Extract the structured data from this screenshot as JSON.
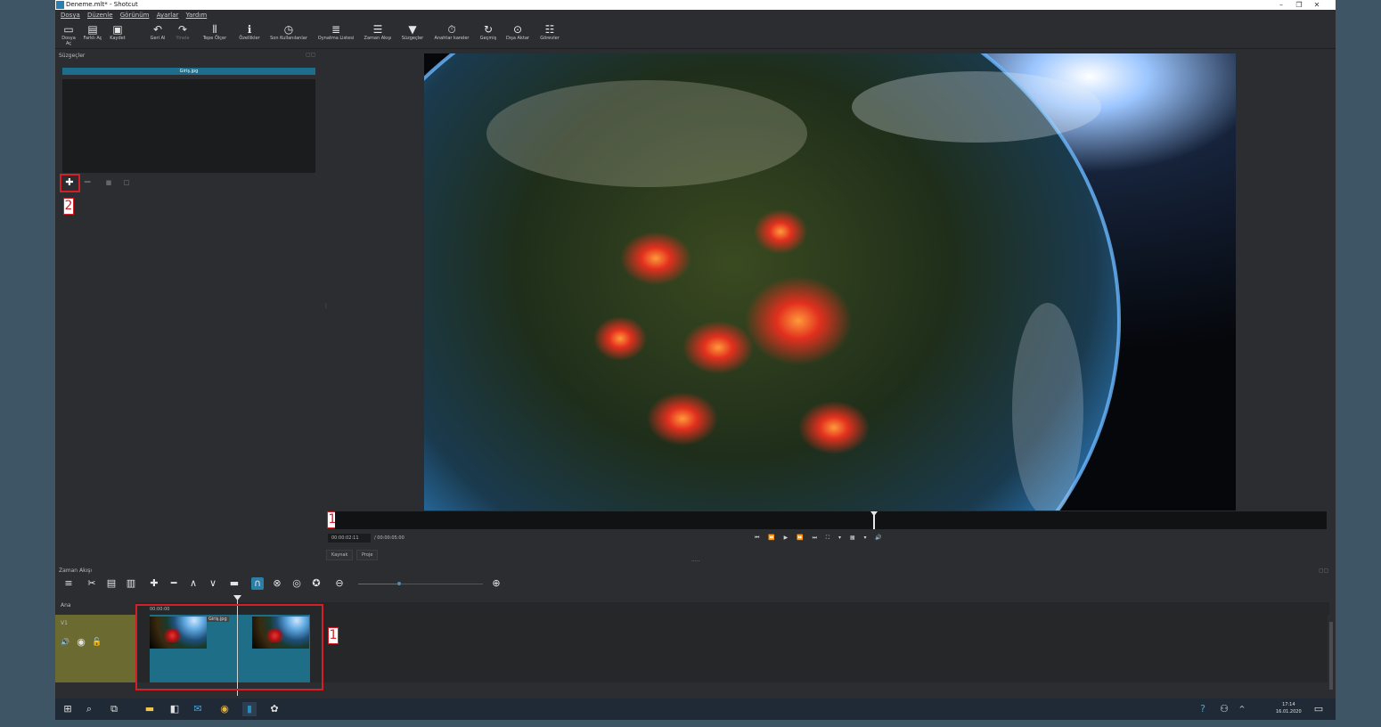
{
  "window": {
    "title": "Deneme.mlt* - Shotcut",
    "controls": [
      "–",
      "❐",
      "✕"
    ]
  },
  "menu": [
    "Dosya",
    "Düzenle",
    "Görünüm",
    "Ayarlar",
    "Yardım"
  ],
  "toolbar": [
    {
      "label": "Dosya Aç",
      "icon": "folder-open-icon",
      "glyph": "▭"
    },
    {
      "label": "Farklı Aç",
      "icon": "open-other-icon",
      "glyph": "▤"
    },
    {
      "label": "Kaydet",
      "icon": "save-icon",
      "glyph": "▣"
    },
    {
      "label": "Geri Al",
      "icon": "undo-icon",
      "glyph": "↶"
    },
    {
      "label": "Yinele",
      "icon": "redo-icon",
      "glyph": "↷"
    },
    {
      "label": "Tepe Ölçer",
      "icon": "peak-meter-icon",
      "glyph": "⫴"
    },
    {
      "label": "Özellikler",
      "icon": "properties-icon",
      "glyph": "ℹ"
    },
    {
      "label": "Son Kullanılanlar",
      "icon": "recent-icon",
      "glyph": "◷"
    },
    {
      "label": "Oynatma Listesi",
      "icon": "playlist-icon",
      "glyph": "≣"
    },
    {
      "label": "Zaman Akışı",
      "icon": "timeline-icon",
      "glyph": "☰"
    },
    {
      "label": "Süzgeçler",
      "icon": "filter-icon",
      "glyph": "▼"
    },
    {
      "label": "Anahtar kareler",
      "icon": "keyframes-icon",
      "glyph": "⏱"
    },
    {
      "label": "Geçmiş",
      "icon": "history-icon",
      "glyph": "↻"
    },
    {
      "label": "Dışa Aktar",
      "icon": "export-icon",
      "glyph": "⊙"
    },
    {
      "label": "Görevler",
      "icon": "jobs-icon",
      "glyph": "☷"
    }
  ],
  "filters_panel": {
    "title": "Süzgeçler",
    "clip_name": "Giriş.jpg"
  },
  "annotations": {
    "label1": "1",
    "label2": "2"
  },
  "player": {
    "timecode": "00:00:02:11",
    "duration": "/ 00:00:05:00",
    "tabs": [
      "Kaynak",
      "Proje"
    ]
  },
  "timeline": {
    "title": "Zaman Akışı",
    "ruler_label": "Ana",
    "ruler_time": "00:00:00",
    "track_name": "V1",
    "clip_name": "Giriş.jpg",
    "zoom_level": 0.32
  },
  "taskbar": {
    "time": "17:14",
    "date": "16.01.2020"
  }
}
